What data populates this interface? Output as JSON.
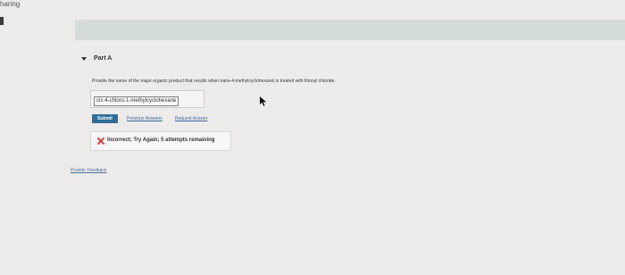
{
  "page": {
    "corner_text": "haring"
  },
  "part": {
    "title": "Part A"
  },
  "question": {
    "text": "Provide the name of the major organic product that results when trans-4-methylcyclohexanol is treated with thionyl chloride."
  },
  "answer": {
    "value": "cis-4-chloro-1-methylcyclohexane"
  },
  "actions": {
    "submit_label": "Submit",
    "previous_answers_label": "Previous Answers",
    "request_answer_label": "Request Answer"
  },
  "feedback": {
    "message": "Incorrect; Try Again; 5 attempts remaining",
    "status_color": "#d62b2b"
  },
  "footer": {
    "provide_feedback_label": "Provide Feedback"
  },
  "icons": {
    "incorrect": "close-icon",
    "part_toggle": "chevron-down-icon",
    "pointer": "cursor-icon"
  }
}
